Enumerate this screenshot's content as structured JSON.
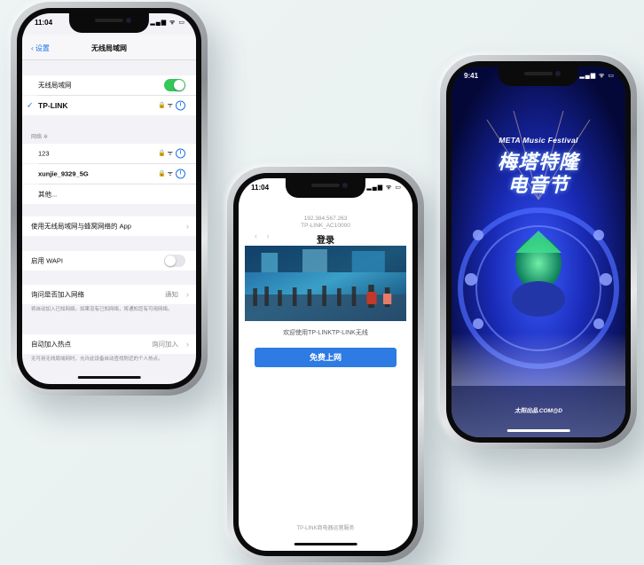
{
  "phone_settings": {
    "status_time": "11:04",
    "status_icons": "▂▄▆ ᯤ ▭",
    "nav_back": "设置",
    "nav_title": "无线局域网",
    "wlan_label": "无线局域网",
    "wlan_toggle": "on",
    "connected_network": "TP-LINK",
    "network_icons": "🔒 ᯤ",
    "networks_section_label": "网络",
    "networks": [
      "123",
      "xunjie_9329_5G",
      "其他..."
    ],
    "use_wlan_cellular_label": "使用无线局域网与蜂窝网络的 App",
    "wapi_label": "启用 WAPI",
    "wapi_toggle": "off",
    "ask_join_label": "询问是否加入网络",
    "ask_join_value": "通知",
    "ask_join_note": "将自动加入已知网络。如果没有已知网络，将通知您有可用网络。",
    "auto_hotspot_label": "自动加入热点",
    "auto_hotspot_value": "询问加入",
    "auto_hotspot_note": "无可用无线局域网时，允许此设备自动查找附近的个人热点。"
  },
  "phone_portal": {
    "status_time": "11:04",
    "status_icons": "▂▄▆ ᯤ ▭",
    "ip_line1": "192.384.567.263",
    "ip_line2": "TP-LINK_AC10000",
    "nav_prev": "‹",
    "nav_next": "›",
    "title": "登录",
    "welcome": "欢迎使用TP-LINKTP-LINK无线",
    "button_label": "免费上网",
    "footer": "TP-LINK商电器运营服务"
  },
  "phone_festival": {
    "status_time": "9:41",
    "status_icons": "▂▄▆ ᯤ ▭",
    "subtitle": "META Music Festival",
    "title_line1": "梅塔特隆",
    "title_line2": "电音节",
    "bottom_text": "太阳出品.COM@D"
  },
  "colors": {
    "background": "#eaf1f1",
    "ios_blue": "#1a73e8",
    "toggle_on": "#34c759",
    "portal_button": "#2d7be3",
    "festival_bg": "#050a3a"
  }
}
